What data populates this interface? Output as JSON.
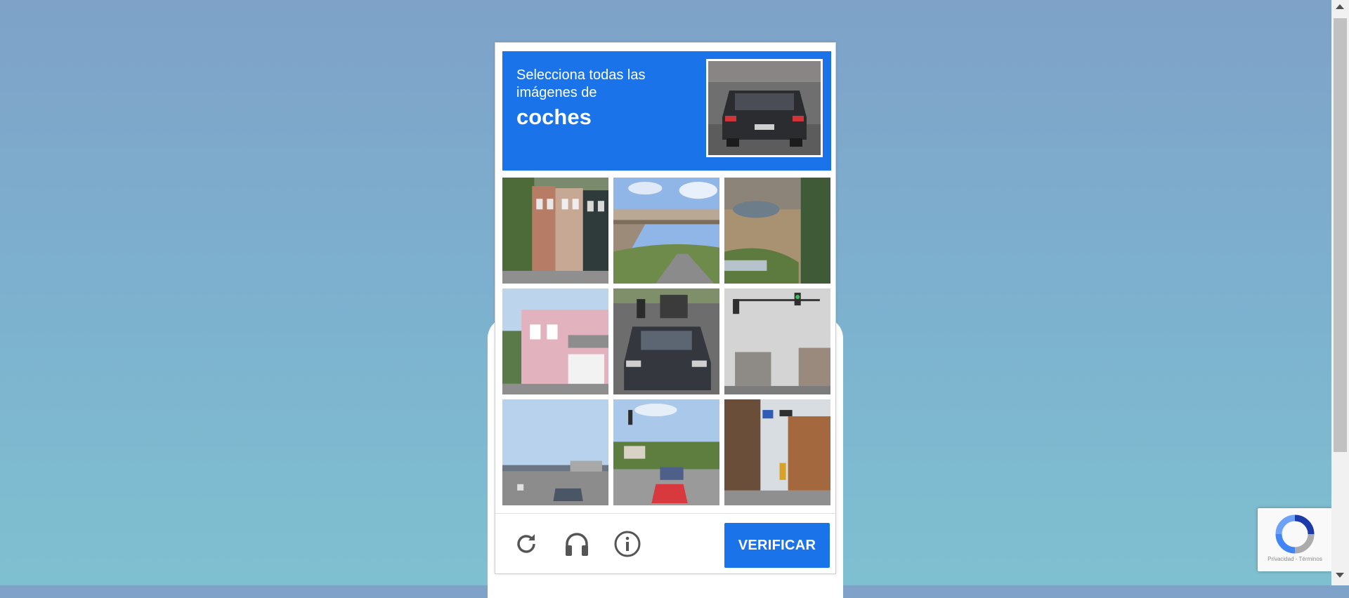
{
  "challenge": {
    "instruction_line1": "Selecciona todas las",
    "instruction_line2": "imágenes de",
    "target": "coches",
    "sample_image": "sample-dark-car-rear",
    "tiles": [
      {
        "image": "townhouses-street"
      },
      {
        "image": "highway-overpass"
      },
      {
        "image": "roadside-vegetation"
      },
      {
        "image": "pink-building-street"
      },
      {
        "image": "traffic-cars-motorbike"
      },
      {
        "image": "traffic-light-buildings"
      },
      {
        "image": "highway-with-car"
      },
      {
        "image": "intersection-red-car"
      },
      {
        "image": "street-trees-signs"
      }
    ],
    "footer": {
      "reload_icon": "reload-icon",
      "audio_icon": "headphones-icon",
      "info_icon": "info-icon",
      "verify_label": "VERIFICAR"
    }
  },
  "badge": {
    "text": "Privacidad - Términos",
    "logo_icon": "recaptcha-logo-icon"
  },
  "colors": {
    "accent": "#1a73e8",
    "icon": "#555555"
  }
}
